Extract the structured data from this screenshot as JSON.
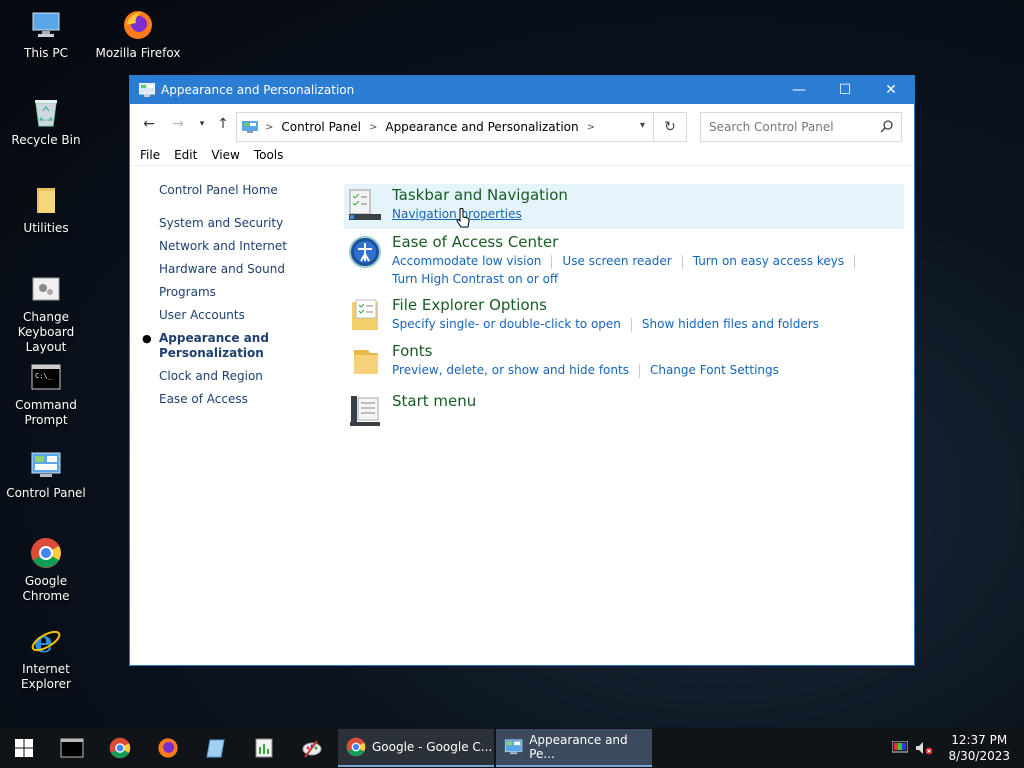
{
  "desktop": {
    "icons": [
      {
        "label": "This PC"
      },
      {
        "label": "Mozilla Firefox"
      },
      {
        "label": "Recycle Bin"
      },
      {
        "label": "Utilities"
      },
      {
        "label": "Change Keyboard Layout"
      },
      {
        "label": "Command Prompt"
      },
      {
        "label": "Control Panel"
      },
      {
        "label": "Google Chrome"
      },
      {
        "label": "Internet Explorer"
      }
    ]
  },
  "window": {
    "title": "Appearance and Personalization",
    "controls": {
      "minimize": "—",
      "maximize": "☐",
      "close": "✕"
    },
    "address": {
      "crumbs": [
        "Control Panel",
        "Appearance and Personalization"
      ]
    },
    "search": {
      "placeholder": "Search Control Panel"
    },
    "menu": [
      "File",
      "Edit",
      "View",
      "Tools"
    ],
    "left_nav": {
      "home": "Control Panel Home",
      "items": [
        "System and Security",
        "Network and Internet",
        "Hardware and Sound",
        "Programs",
        "User Accounts",
        "Appearance and Personalization",
        "Clock and Region",
        "Ease of Access"
      ]
    },
    "categories": [
      {
        "title": "Taskbar and Navigation",
        "links": [
          "Navigation properties"
        ]
      },
      {
        "title": "Ease of Access Center",
        "links": [
          "Accommodate low vision",
          "Use screen reader",
          "Turn on easy access keys",
          "Turn High Contrast on or off"
        ]
      },
      {
        "title": "File Explorer Options",
        "links": [
          "Specify single- or double-click to open",
          "Show hidden files and folders"
        ]
      },
      {
        "title": "Fonts",
        "links": [
          "Preview, delete, or show and hide fonts",
          "Change Font Settings"
        ]
      },
      {
        "title": "Start menu",
        "links": []
      }
    ]
  },
  "taskbar": {
    "tasks": [
      {
        "label": "Google - Google C..."
      },
      {
        "label": "Appearance and Pe..."
      }
    ],
    "clock": {
      "time": "12:37 PM",
      "date": "8/30/2023"
    }
  }
}
